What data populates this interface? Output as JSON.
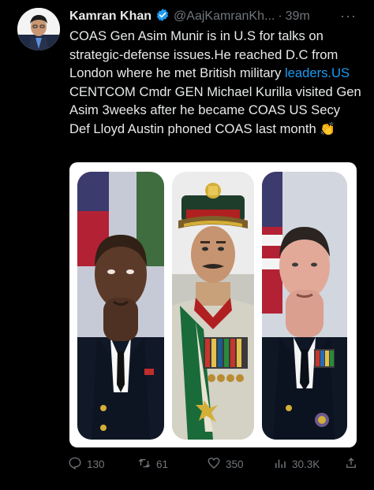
{
  "author": {
    "name": "Kamran Khan",
    "handle": "@AajKamranKh...",
    "separator": "·",
    "time": "39m",
    "more": "···"
  },
  "tweet": {
    "text_before": "COAS Gen Asim Munir is in U.S for talks on strategic-defense issues.He reached D.C from London where he met British military ",
    "link": "leaders.US",
    "text_after": " CENTCOM Cmdr GEN Michael Kurilla visited Gen Asim 3weeks after he became COAS US Secy Def Lloyd Austin phoned COAS last month ",
    "emoji": "👏"
  },
  "actions": {
    "replies": "130",
    "retweets": "61",
    "likes": "350",
    "views": "30.3K"
  },
  "colors": {
    "accent": "#1d9bf0",
    "muted": "#71767b",
    "background": "#000000"
  }
}
